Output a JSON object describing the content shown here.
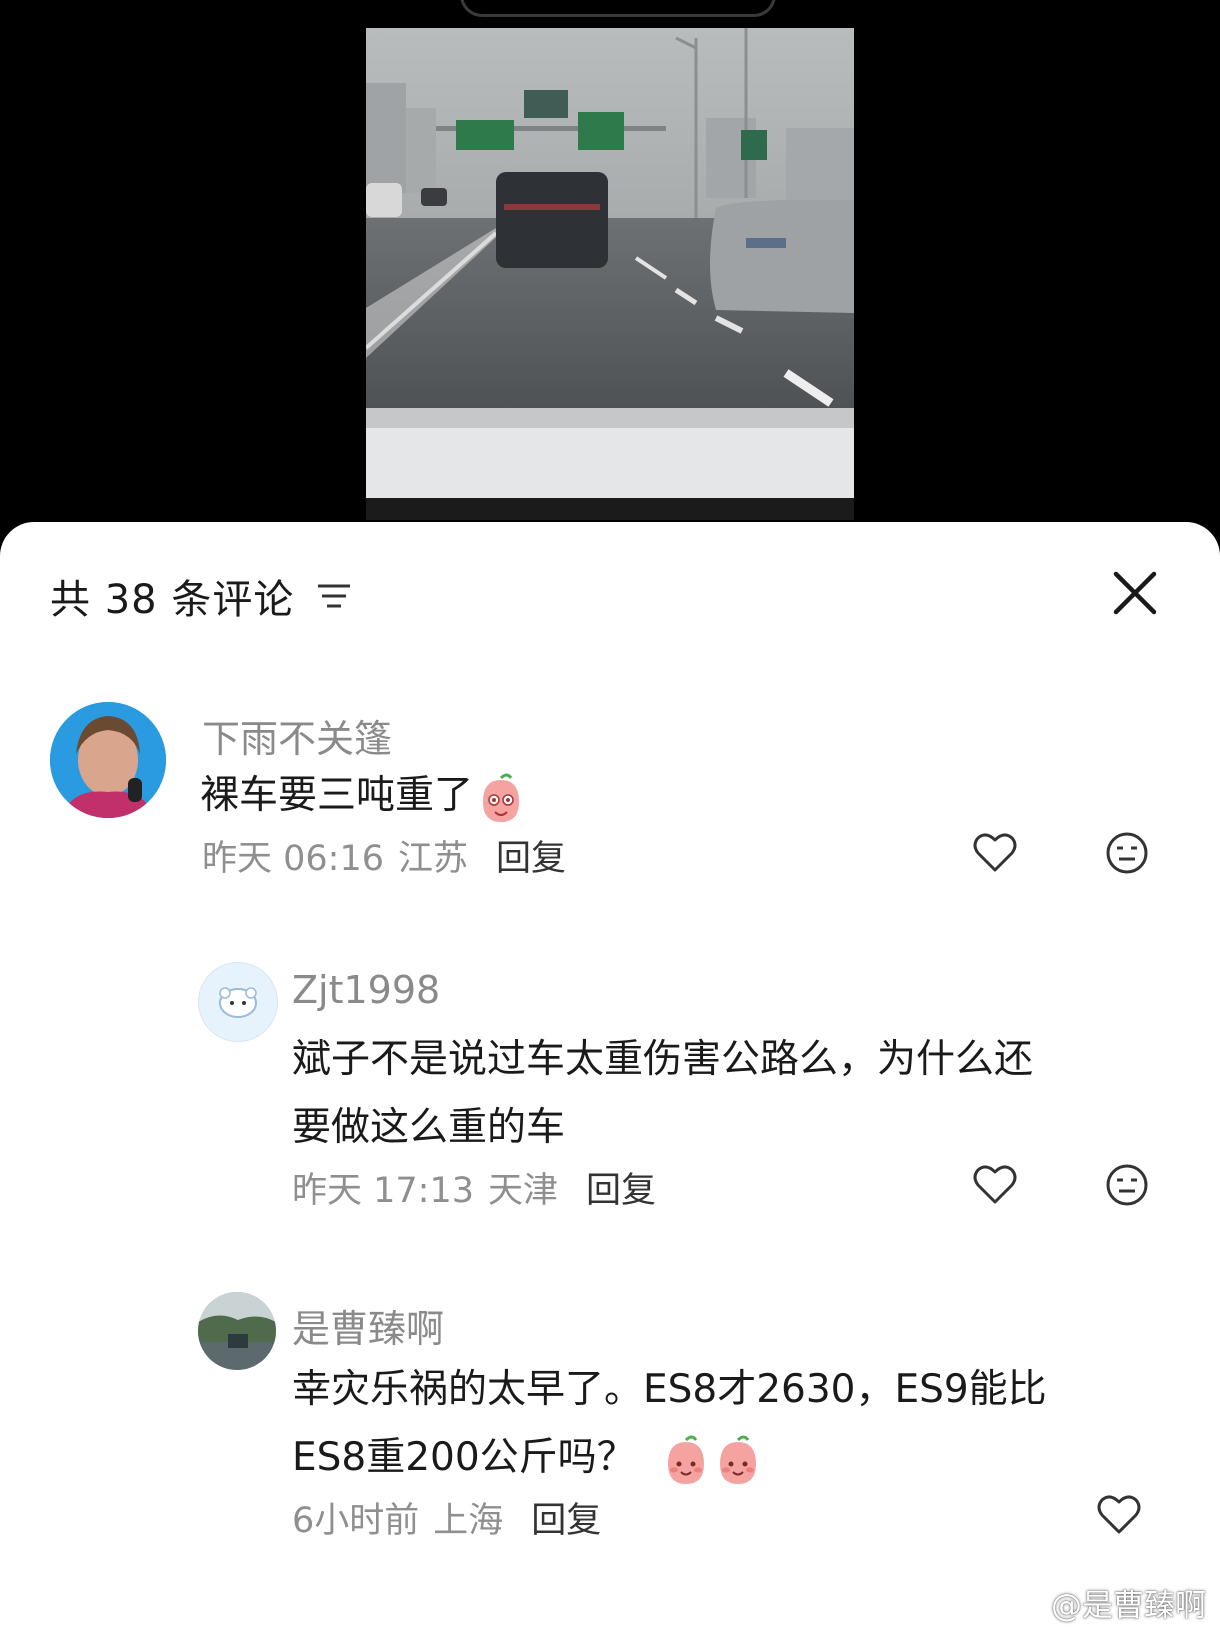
{
  "header": {
    "comment_count_label": "共 38 条评论"
  },
  "comments": [
    {
      "username": "下雨不关篷",
      "text": "裸车要三吨重了",
      "emoji_icons": [
        "peach-face-emoji"
      ],
      "time": "昨天 06:16",
      "location": "江苏",
      "reply_label": "回复"
    },
    {
      "username": "Zjt1998",
      "text_lines": [
        "斌子不是说过车太重伤害公路么，为什么还",
        "要做这么重的车"
      ],
      "time": "昨天 17:13",
      "location": "天津",
      "reply_label": "回复"
    },
    {
      "username": "是曹臻啊",
      "text_lines": [
        "幸灾乐祸的太早了。ES8才2630，ES9能比",
        "ES8重200公斤吗？"
      ],
      "emoji_icons": [
        "peach-face-emoji",
        "peach-face-emoji"
      ],
      "time": "6小时前",
      "location": "上海",
      "reply_label": "回复"
    }
  ],
  "watermark": "@是曹臻啊",
  "icons": {
    "sort": "filter-lines-icon",
    "close": "close-icon",
    "like": "heart-icon",
    "dislike": "neutral-face-icon"
  },
  "colors": {
    "sheet_bg": "#ffffff",
    "username": "#8a8a8a",
    "meta": "#8f8f8f",
    "text": "#1a1a1a",
    "backdrop": "#000000"
  }
}
